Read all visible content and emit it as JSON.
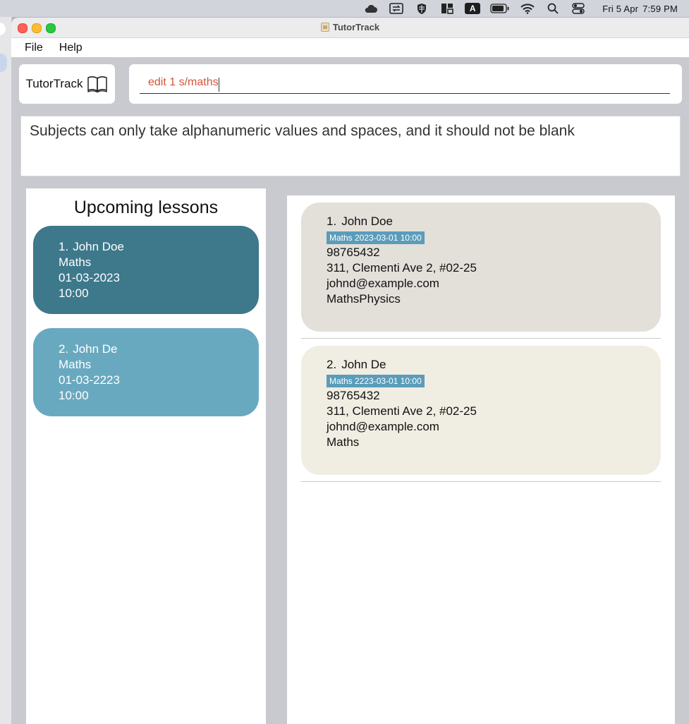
{
  "menubar": {
    "icons": [
      "cloud-icon",
      "screen-share-icon",
      "shield-icon",
      "window-layout-icon",
      "input-source-icon",
      "battery-icon",
      "wifi-icon",
      "search-icon",
      "control-center-icon"
    ],
    "input_source": "A",
    "date": "Fri 5 Apr",
    "time": "7:59 PM"
  },
  "window": {
    "title": "TutorTrack",
    "menu": [
      "File",
      "Help"
    ]
  },
  "brand": {
    "label": "TutorTrack",
    "icon": "book-icon"
  },
  "command": {
    "value": "edit 1 s/maths",
    "color": "#d0553c"
  },
  "result": {
    "message": "Subjects can only take alphanumeric values and spaces, and it should not be blank"
  },
  "upcoming": {
    "title": "Upcoming lessons",
    "lessons": [
      {
        "index": "1.",
        "name": "John Doe",
        "subject": "Maths",
        "date": "01-03-2023",
        "time": "10:00",
        "color": "#3d788b"
      },
      {
        "index": "2.",
        "name": "John De",
        "subject": "Maths",
        "date": "01-03-2223",
        "time": "10:00",
        "color": "#69a9c0"
      }
    ]
  },
  "persons": [
    {
      "index": "1.",
      "name": "John Doe",
      "tag": "Maths 2023-03-01 10:00",
      "phone": "98765432",
      "address": "311, Clementi Ave 2, #02-25",
      "email": "johnd@example.com",
      "subjects": "MathsPhysics"
    },
    {
      "index": "2.",
      "name": "John De",
      "tag": "Maths 2223-03-01 10:00",
      "phone": "98765432",
      "address": "311, Clementi Ave 2, #02-25",
      "email": "johnd@example.com",
      "subjects": "Maths"
    }
  ]
}
